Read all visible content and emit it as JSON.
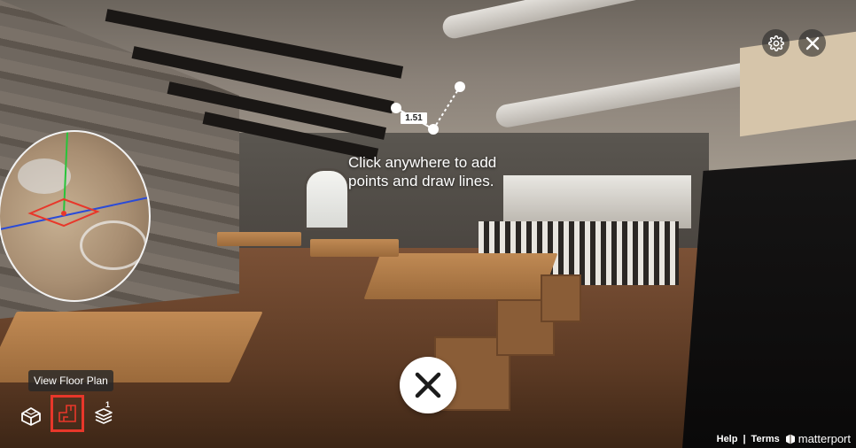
{
  "instruction": {
    "line1": "Click anywhere to add",
    "line2": "points and draw lines."
  },
  "measurement": {
    "label": "1.51"
  },
  "tooltip": {
    "text": "View Floor Plan"
  },
  "floors": {
    "count": "1"
  },
  "footer": {
    "help": "Help",
    "separator": "|",
    "terms": "Terms",
    "brand": "matterport"
  },
  "colors": {
    "highlight": "#e8372a",
    "overlay": "#282828"
  },
  "icons": {
    "settings": "gear-icon",
    "close": "close-icon",
    "dollhouse": "dollhouse-icon",
    "floorplan": "floorplan-icon",
    "floors": "floors-icon",
    "brand": "matterport-logo-icon"
  }
}
